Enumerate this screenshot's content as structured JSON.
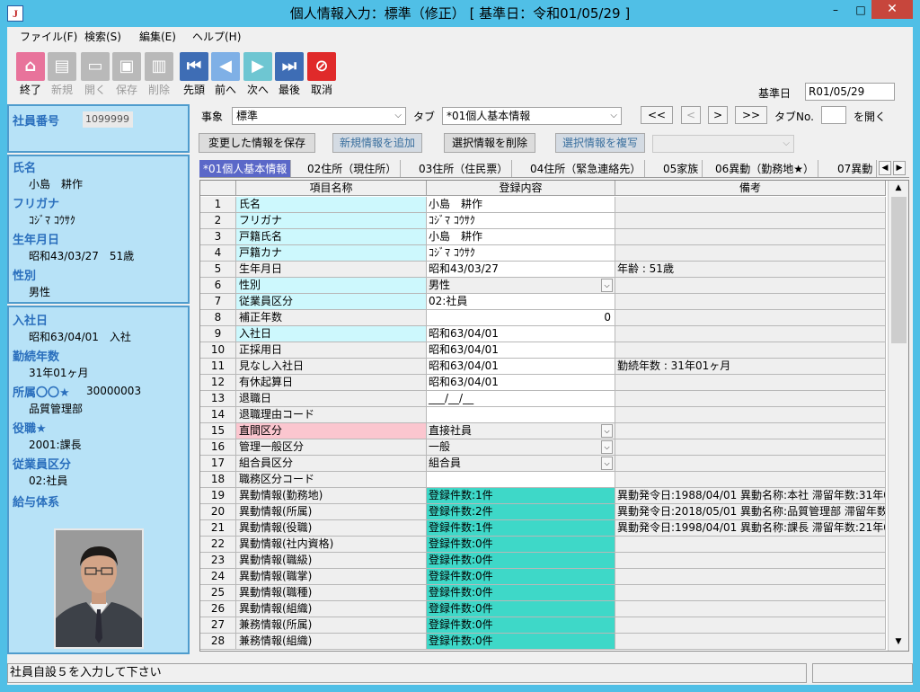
{
  "window": {
    "title": "個人情報入力：標準（修正） [ 基準日：令和01/05/29 ]",
    "app_icon": "J",
    "minimize": "–",
    "maximize": "□",
    "close": "✕"
  },
  "menu": [
    "ファイル(F)",
    "検索(S)",
    "編集(E)",
    "ヘルプ(H)"
  ],
  "toolbar": [
    {
      "label": "終了",
      "icon": "home-icon",
      "glyph": "⌂",
      "color": "#e8739b",
      "enabled": true
    },
    {
      "label": "新規",
      "icon": "new-doc-icon",
      "glyph": "▤",
      "color": "#b9b9b9",
      "enabled": false
    },
    {
      "label": "開く",
      "icon": "open-icon",
      "glyph": "▭",
      "color": "#b9b9b9",
      "enabled": false
    },
    {
      "label": "保存",
      "icon": "save-icon",
      "glyph": "▣",
      "color": "#b9b9b9",
      "enabled": false
    },
    {
      "label": "削除",
      "icon": "trash-icon",
      "glyph": "▥",
      "color": "#b9b9b9",
      "enabled": false
    },
    {
      "label": "先頭",
      "icon": "first-record-icon",
      "glyph": "⏮",
      "color": "#3e6db5",
      "enabled": true
    },
    {
      "label": "前へ",
      "icon": "prev-record-icon",
      "glyph": "◀",
      "color": "#7fb0e6",
      "enabled": true
    },
    {
      "label": "次へ",
      "icon": "next-record-icon",
      "glyph": "▶",
      "color": "#6ec6d2",
      "enabled": true
    },
    {
      "label": "最後",
      "icon": "last-record-icon",
      "glyph": "⏭",
      "color": "#3e6db5",
      "enabled": true
    },
    {
      "label": "取消",
      "icon": "cancel-icon",
      "glyph": "⊘",
      "color": "#e02a2a",
      "enabled": true
    }
  ],
  "base_date": {
    "label": "基準日",
    "value": "R01/05/29"
  },
  "left_panel": {
    "emp_no_label": "社員番号",
    "emp_no_value": "1099999",
    "name_label": "氏名",
    "name_value": "小島　耕作",
    "kana_label": "フリガナ",
    "kana_value": "ｺｼﾞﾏ ｺｳｻｸ",
    "birth_label": "生年月日",
    "birth_value": "昭和43/03/27　51歳",
    "gender_label": "性別",
    "gender_value": "男性",
    "join_label": "入社日",
    "join_value": "昭和63/04/01　入社",
    "tenure_label": "勤続年数",
    "tenure_value": "31年01ヶ月",
    "dept_label": "所属〇〇★",
    "dept_code": "30000003",
    "dept_value": "品質管理部",
    "post_label": "役職★",
    "post_value": "2001:課長",
    "emp_type_label": "従業員区分",
    "emp_type_value": "02:社員",
    "pay_label": "給与体系"
  },
  "controls": {
    "jishou_label": "事象",
    "jishou_value": "標準",
    "tab_label": "タブ",
    "tab_value": "*01個人基本情報",
    "nav_first": "<<",
    "nav_prev": "<",
    "nav_next": ">",
    "nav_last": ">>",
    "tab_no_label": "タブNo.",
    "tab_no_value": "",
    "open_label": "を開く",
    "save_changes": "変更した情報を保存",
    "add_new": "新規情報を追加",
    "delete_selected": "選択情報を削除",
    "copy_selected": "選択情報を複写"
  },
  "tabs": [
    "*01個人基本情報",
    "02住所（現住所）",
    "03住所（住民票）",
    "04住所（緊急連絡先）",
    "05家族",
    "06異動（勤務地★）",
    "07異動"
  ],
  "grid": {
    "headers": [
      "",
      "項目名称",
      "登録内容",
      "備考"
    ],
    "rows": [
      {
        "no": "1",
        "item": "氏名",
        "value": "小島　耕作",
        "note": "",
        "style": "cyan",
        "vstyle": ""
      },
      {
        "no": "2",
        "item": "フリガナ",
        "value": "ｺｼﾞﾏ ｺｳｻｸ",
        "note": "",
        "style": "cyan",
        "vstyle": ""
      },
      {
        "no": "3",
        "item": "戸籍氏名",
        "value": "小島　耕作",
        "note": "",
        "style": "cyan",
        "vstyle": ""
      },
      {
        "no": "4",
        "item": "戸籍カナ",
        "value": "ｺｼﾞﾏ ｺｳｻｸ",
        "note": "",
        "style": "cyan",
        "vstyle": ""
      },
      {
        "no": "5",
        "item": "生年月日",
        "value": "昭和43/03/27",
        "note": "年齢 : 51歳",
        "style": "",
        "vstyle": ""
      },
      {
        "no": "6",
        "item": "性別",
        "value": "男性",
        "note": "",
        "style": "cyan",
        "vstyle": "combo"
      },
      {
        "no": "7",
        "item": "従業員区分",
        "value": "02:社員",
        "note": "",
        "style": "cyan",
        "vstyle": ""
      },
      {
        "no": "8",
        "item": "補正年数",
        "value": "0",
        "note": "",
        "style": "",
        "vstyle": "right"
      },
      {
        "no": "9",
        "item": "入社日",
        "value": "昭和63/04/01",
        "note": "",
        "style": "cyan",
        "vstyle": ""
      },
      {
        "no": "10",
        "item": "正採用日",
        "value": "昭和63/04/01",
        "note": "",
        "style": "",
        "vstyle": ""
      },
      {
        "no": "11",
        "item": "見なし入社日",
        "value": "昭和63/04/01",
        "note": "勤続年数 : 31年01ヶ月",
        "style": "",
        "vstyle": ""
      },
      {
        "no": "12",
        "item": "有休起算日",
        "value": "昭和63/04/01",
        "note": "",
        "style": "",
        "vstyle": ""
      },
      {
        "no": "13",
        "item": "退職日",
        "value": "___/__/__",
        "note": "",
        "style": "",
        "vstyle": ""
      },
      {
        "no": "14",
        "item": "退職理由コード",
        "value": "",
        "note": "",
        "style": "",
        "vstyle": ""
      },
      {
        "no": "15",
        "item": "直間区分",
        "value": "直接社員",
        "note": "",
        "style": "pink",
        "vstyle": "combo"
      },
      {
        "no": "16",
        "item": "管理一般区分",
        "value": "一般",
        "note": "",
        "style": "",
        "vstyle": "combo"
      },
      {
        "no": "17",
        "item": "組合員区分",
        "value": "組合員",
        "note": "",
        "style": "",
        "vstyle": "combo"
      },
      {
        "no": "18",
        "item": "職務区分コード",
        "value": "",
        "note": "",
        "style": "",
        "vstyle": ""
      },
      {
        "no": "19",
        "item": "異動情報(勤務地)",
        "value": "登録件数:1件",
        "note": "異動発令日:1988/04/01 異動名称:本社 滞留年数:31年0",
        "style": "",
        "vstyle": "teal"
      },
      {
        "no": "20",
        "item": "異動情報(所属)",
        "value": "登録件数:2件",
        "note": "異動発令日:2018/05/01 異動名称:品質管理部 滞留年数",
        "style": "",
        "vstyle": "teal"
      },
      {
        "no": "21",
        "item": "異動情報(役職)",
        "value": "登録件数:1件",
        "note": "異動発令日:1998/04/01 異動名称:課長 滞留年数:21年0",
        "style": "",
        "vstyle": "teal"
      },
      {
        "no": "22",
        "item": "異動情報(社内資格)",
        "value": "登録件数:0件",
        "note": "",
        "style": "",
        "vstyle": "teal"
      },
      {
        "no": "23",
        "item": "異動情報(職級)",
        "value": "登録件数:0件",
        "note": "",
        "style": "",
        "vstyle": "teal"
      },
      {
        "no": "24",
        "item": "異動情報(職掌)",
        "value": "登録件数:0件",
        "note": "",
        "style": "",
        "vstyle": "teal"
      },
      {
        "no": "25",
        "item": "異動情報(職種)",
        "value": "登録件数:0件",
        "note": "",
        "style": "",
        "vstyle": "teal"
      },
      {
        "no": "26",
        "item": "異動情報(組織)",
        "value": "登録件数:0件",
        "note": "",
        "style": "",
        "vstyle": "teal"
      },
      {
        "no": "27",
        "item": "兼務情報(所属)",
        "value": "登録件数:0件",
        "note": "",
        "style": "",
        "vstyle": "teal"
      },
      {
        "no": "28",
        "item": "兼務情報(組織)",
        "value": "登録件数:0件",
        "note": "",
        "style": "",
        "vstyle": "teal"
      }
    ]
  },
  "status": {
    "message": "社員自設５を入力して下さい"
  }
}
